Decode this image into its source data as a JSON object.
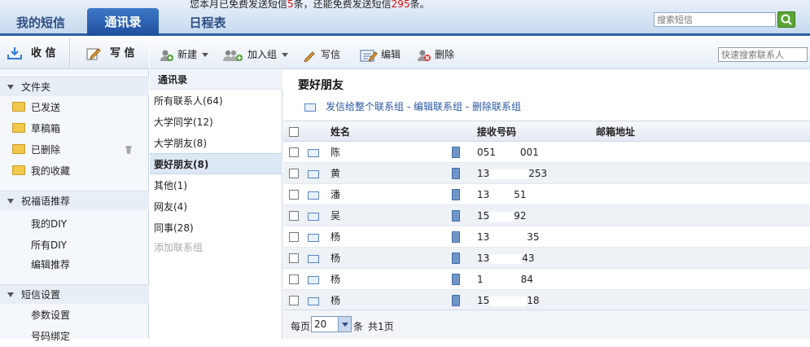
{
  "notice": {
    "pre": "您本月已免费发送短信",
    "sent": "5",
    "mid": "条，还能免费发送短信",
    "remain": "295",
    "post": "条。"
  },
  "tabs": {
    "sms": "我的短信",
    "contacts": "通讯录",
    "schedule": "日程表"
  },
  "search_sms": {
    "placeholder": "搜索短信"
  },
  "sidebar": {
    "inbox": "收 信",
    "compose": "写 信",
    "folders_head": "文件夹",
    "folders": [
      "已发送",
      "草稿箱",
      "已删除",
      "我的收藏"
    ],
    "greet_head": "祝福语推荐",
    "greet": [
      "我的DIY",
      "所有DIY",
      "编辑推荐"
    ],
    "settings_head": "短信设置",
    "settings": [
      "参数设置",
      "号码绑定"
    ]
  },
  "toolbar": {
    "new": "新建",
    "add_group": "加入组",
    "write": "写信",
    "edit": "编辑",
    "delete": "删除",
    "search_placeholder": "快速搜索联系人"
  },
  "groups": {
    "head": "通讯录",
    "items": [
      "所有联系人(64)",
      "大学同学(12)",
      "大学朋友(8)",
      "要好朋友(8)",
      "其他(1)",
      "网友(4)",
      "同事(28)"
    ],
    "selected": "要好朋友(8)",
    "add": "添加联系组"
  },
  "main": {
    "title": "要好朋友",
    "actions": [
      "发信给整个联系组",
      "编辑联系组",
      "删除联系组"
    ],
    "sep": "-",
    "columns": {
      "name": "姓名",
      "phone": "接收号码",
      "email": "邮箱地址"
    },
    "rows": [
      {
        "name": "陈",
        "phone": [
          "051",
          "001"
        ]
      },
      {
        "name": "黄",
        "phone": [
          "13",
          "253"
        ]
      },
      {
        "name": "潘",
        "phone": [
          "13",
          "51"
        ]
      },
      {
        "name": "吴",
        "phone": [
          "15",
          "92"
        ]
      },
      {
        "name": "杨",
        "phone": [
          "13",
          "35"
        ]
      },
      {
        "name": "杨",
        "phone": [
          "13",
          "43"
        ]
      },
      {
        "name": "杨",
        "phone": [
          "1",
          "84"
        ]
      },
      {
        "name": "杨",
        "phone": [
          "15",
          "18"
        ]
      }
    ]
  },
  "pager": {
    "per_page_label": "每页",
    "per_page_value": "20",
    "unit": "条",
    "total": "共1页"
  }
}
